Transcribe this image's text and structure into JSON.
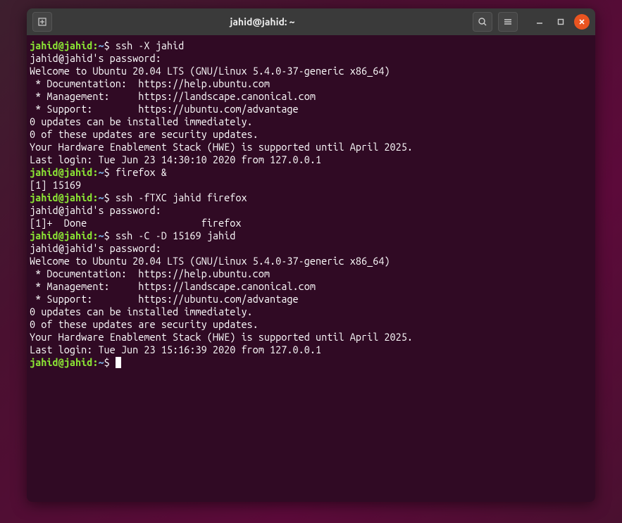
{
  "titlebar": {
    "title": "jahid@jahid: ~"
  },
  "prompts": {
    "userhost": "jahid@jahid",
    "path": "~",
    "sep": ":",
    "dollar": "$"
  },
  "cmds": {
    "c1": "ssh -X jahid",
    "c2": "firefox &",
    "c3": "ssh -fTXC jahid firefox",
    "c4": "ssh -C -D 15169 jahid",
    "c5": ""
  },
  "out": {
    "pwd1": "jahid@jahid's password:",
    "welcome": "Welcome to Ubuntu 20.04 LTS (GNU/Linux 5.4.0-37-generic x86_64)",
    "blank": "",
    "doc": " * Documentation:  https://help.ubuntu.com",
    "mgmt": " * Management:     https://landscape.canonical.com",
    "support": " * Support:        https://ubuntu.com/advantage",
    "upd1": "0 updates can be installed immediately.",
    "upd2": "0 of these updates are security updates.",
    "hwe": "Your Hardware Enablement Stack (HWE) is supported until April 2025.",
    "last1": "Last login: Tue Jun 23 14:30:10 2020 from 127.0.0.1",
    "job1": "[1] 15169",
    "pwd2": "jahid@jahid's password:",
    "done": "[1]+  Done                    firefox",
    "pwd3": "jahid@jahid's password:",
    "last2": "Last login: Tue Jun 23 15:16:39 2020 from 127.0.0.1"
  }
}
